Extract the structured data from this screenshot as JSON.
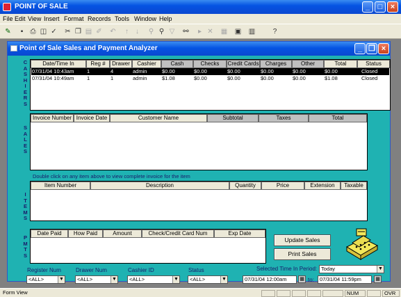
{
  "app": {
    "title": "POINT OF SALE"
  },
  "menu": [
    "File",
    "Edit",
    "View",
    "Insert",
    "Format",
    "Records",
    "Tools",
    "Window",
    "Help"
  ],
  "form": {
    "title": "Point of Sale Sales and Payment Analyzer"
  },
  "sections": {
    "cashiers": "CASHIERS",
    "sales": "SALES",
    "items": "ITEMS",
    "pmts": "PMTS"
  },
  "cashiers": {
    "columns": [
      "Date/Time In",
      "Reg #",
      "Drawer",
      "Cashier",
      "Cash",
      "Checks",
      "Credit Cards",
      "Charges",
      "Other",
      "Total",
      "Status"
    ],
    "rows": [
      [
        "07/31/04 10:43am",
        "1",
        "4",
        "admin",
        "$0.00",
        "$0.00",
        "$0.00",
        "$0.00",
        "$0.00",
        "$0.00",
        "Closed"
      ],
      [
        "07/31/04 10:49am",
        "1",
        "1",
        "admin",
        "$1.08",
        "$0.00",
        "$0.00",
        "$0.00",
        "$0.00",
        "$1.08",
        "Closed"
      ]
    ]
  },
  "sales": {
    "columns": [
      "Invoice Number",
      "Invoice Date",
      "Customer Name",
      "Subtotal",
      "Taxes",
      "Total"
    ],
    "hint": "Double click on any item above to view complete invoice for the item"
  },
  "items": {
    "columns": [
      "Item Number",
      "Description",
      "Quantity",
      "Price",
      "Extension",
      "Taxable"
    ]
  },
  "pmts": {
    "columns": [
      "Date Paid",
      "How Paid",
      "Amount",
      "Check/Credit Card Num",
      "Exp Date"
    ]
  },
  "buttons": {
    "update": "Update Sales",
    "print": "Print Sales"
  },
  "filters": {
    "register_label": "Register Num",
    "register_value": "<ALL>",
    "drawer_label": "Drawer Num",
    "drawer_value": "<ALL>",
    "cashier_label": "Cashier ID",
    "cashier_value": "<ALL>",
    "status_label": "Status",
    "status_value": "<ALL>",
    "period_label": "Selected Time In Period:",
    "period_value": "Today",
    "from": "07/31/04 12:00am",
    "to_label": "to:",
    "to": "07/31/04 11:59pm"
  },
  "statusbar": {
    "left": "Form View",
    "num": "NUM",
    "ovr": "OVR"
  }
}
